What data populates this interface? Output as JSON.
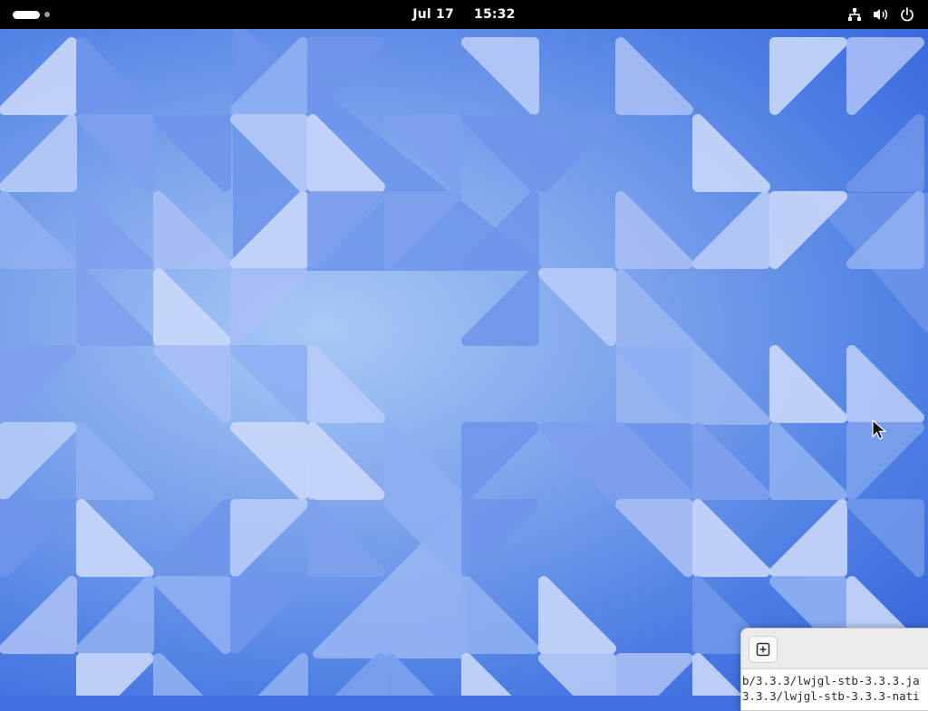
{
  "topbar": {
    "date": "Jul 17",
    "time": "15:32",
    "icons": [
      "network-wired-icon",
      "volume-icon",
      "power-icon"
    ]
  },
  "terminal": {
    "lines": [
      "b/3.3.3/lwjgl-stb-3.3.3.ja",
      "3.3.3/lwjgl-stb-3.3.3-nati"
    ],
    "new_tab_icon": "tab-new-icon"
  },
  "wallpaper": {
    "theme": "blue-triangles",
    "colors": [
      "#2f5fd8",
      "#7fa6ec",
      "#c9d8fb"
    ]
  }
}
